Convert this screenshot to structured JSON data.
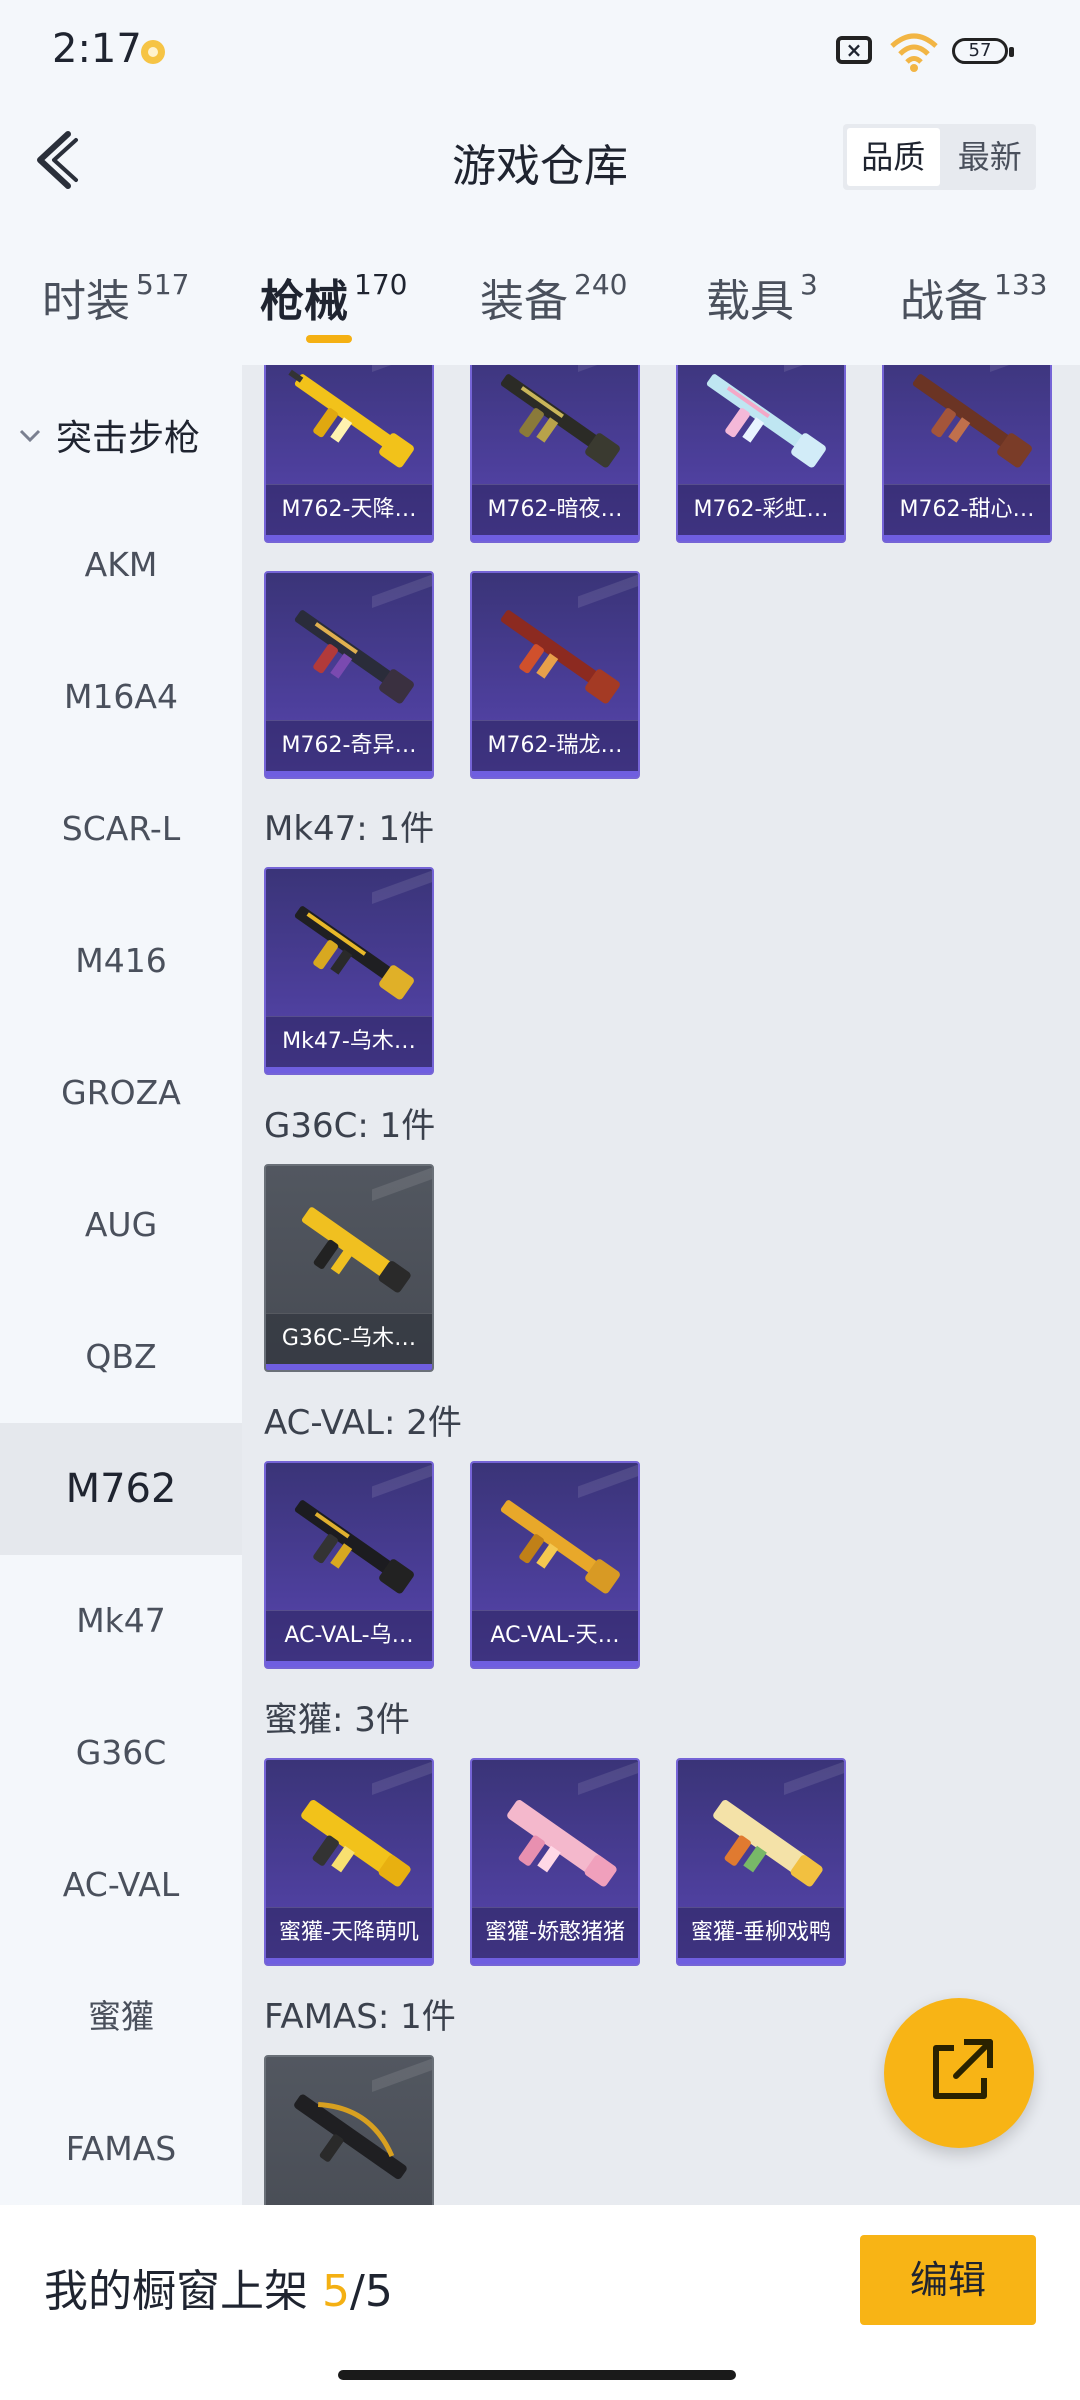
{
  "status": {
    "time": "2:17",
    "battery": "57"
  },
  "header": {
    "title": "游戏仓库",
    "sort_options": [
      "品质",
      "最新"
    ],
    "active_sort": "品质"
  },
  "tabs": [
    {
      "label": "时装",
      "count": "517"
    },
    {
      "label": "枪械",
      "count": "170",
      "active": true
    },
    {
      "label": "装备",
      "count": "240"
    },
    {
      "label": "载具",
      "count": "3"
    },
    {
      "label": "战备",
      "count": "133"
    }
  ],
  "sidebar": {
    "category": "突击步枪",
    "items": [
      "AKM",
      "M16A4",
      "SCAR-L",
      "M416",
      "GROZA",
      "AUG",
      "QBZ",
      "M762",
      "Mk47",
      "G36C",
      "AC-VAL",
      "蜜獾",
      "FAMAS"
    ],
    "active": "M762"
  },
  "groups": {
    "m762_top": [
      "M762-天降…",
      "M762-暗夜…",
      "M762-彩虹…",
      "M762-甜心…"
    ],
    "m762_bottom": [
      "M762-奇异…",
      "M762-瑞龙…"
    ],
    "mk47": {
      "label": "Mk47: 1件",
      "items": [
        "Mk47-乌木…"
      ]
    },
    "g36c": {
      "label": "G36C: 1件",
      "items": [
        "G36C-乌木…"
      ]
    },
    "acval": {
      "label": "AC-VAL: 2件",
      "items": [
        "AC-VAL-乌…",
        "AC-VAL-天…"
      ]
    },
    "honeybadger": {
      "label": "蜜獾: 3件",
      "items": [
        "蜜獾-天降萌叽",
        "蜜獾-娇憨猪猪",
        "蜜獾-垂柳戏鸭"
      ]
    },
    "famas": {
      "label": "FAMAS: 1件"
    }
  },
  "bottom": {
    "label": "我的橱窗上架 ",
    "count": "5",
    "total": "/5",
    "edit": "编辑"
  },
  "colors": {
    "accent": "#f8b415",
    "card_purple": "#4d3f9c",
    "card_gray": "#4f545c"
  }
}
